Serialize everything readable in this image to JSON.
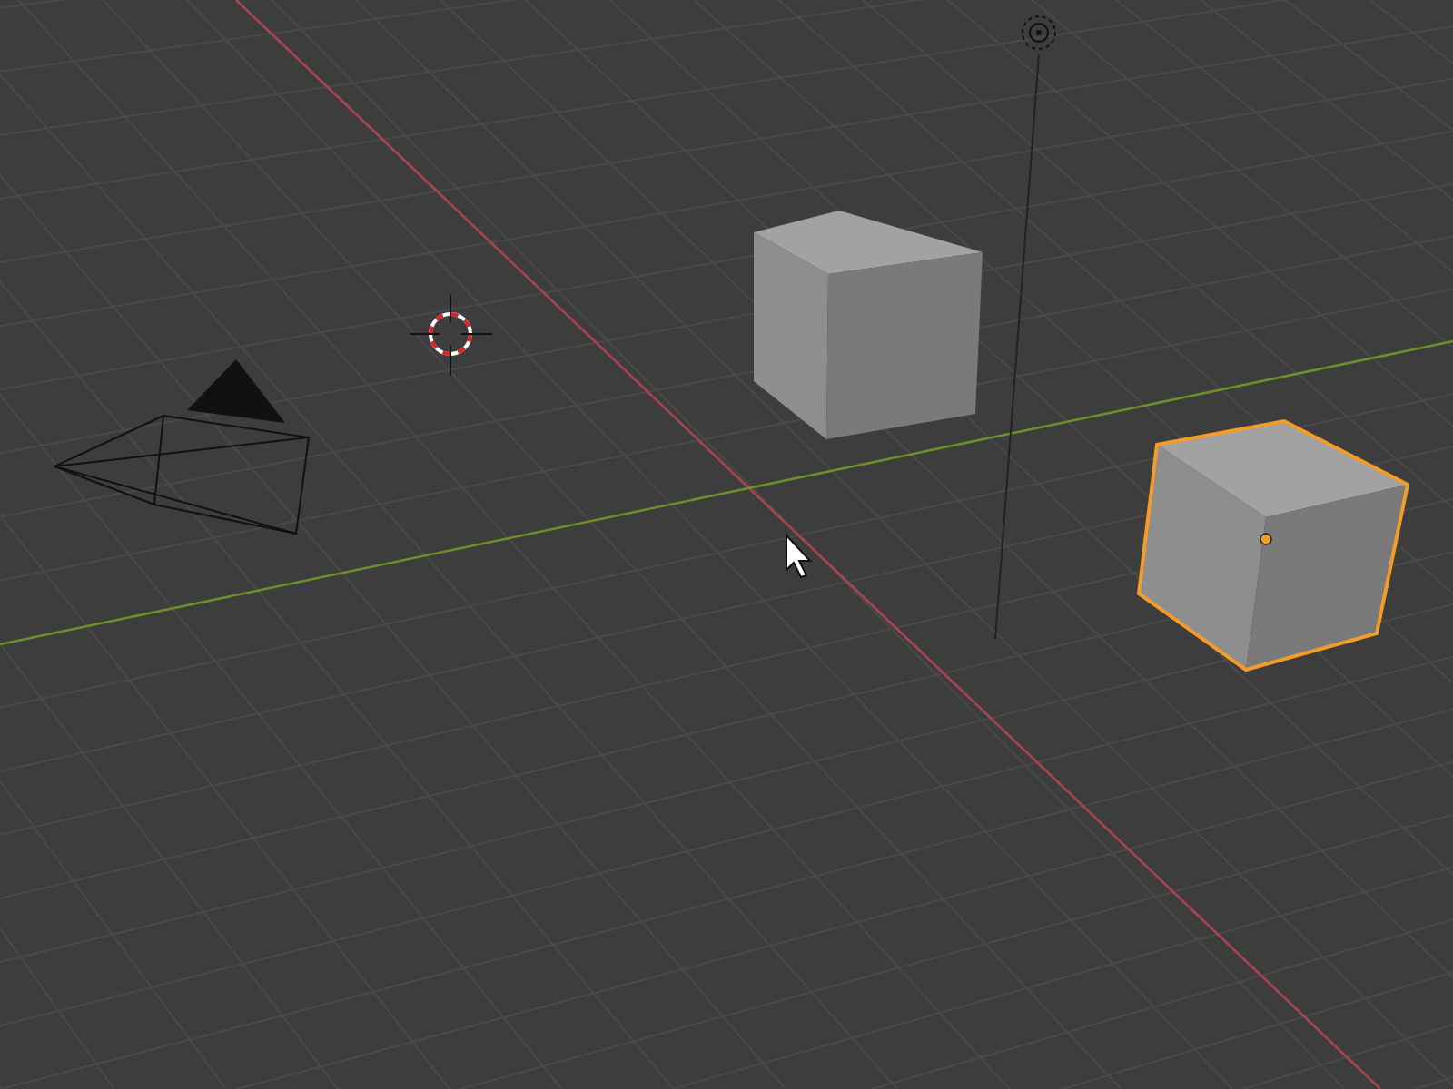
{
  "viewport": {
    "objects": [
      {
        "kind": "camera",
        "selected": false
      },
      {
        "kind": "cube",
        "selected": false
      },
      {
        "kind": "light",
        "selected": false
      },
      {
        "kind": "cube",
        "selected": true
      }
    ],
    "cursor_3d": true,
    "mouse_pointer": true
  }
}
